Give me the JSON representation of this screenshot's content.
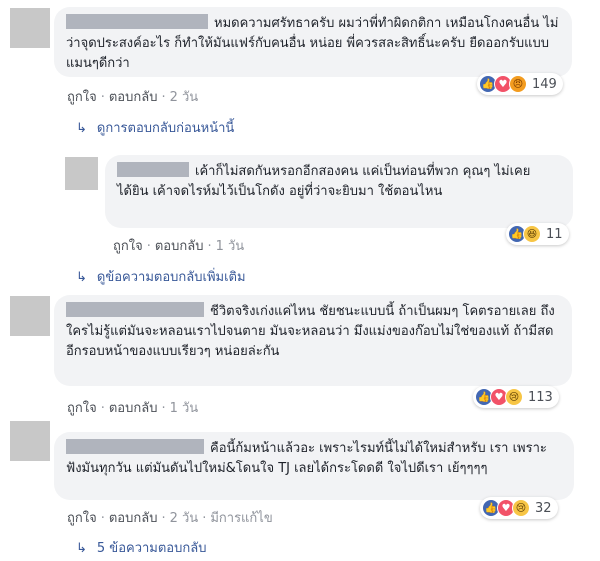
{
  "labels": {
    "like": "ถูกใจ",
    "reply": "ตอบกลับ",
    "dot": "·"
  },
  "comments": [
    {
      "text": "หมดความศรัทธาครับ ผมว่าพี่ทำผิดกติกา เหมือนโกงคนอื่น ไม่ว่าจุดประสงค์อะไร ก็ทำให้มันแฟร์กับคนอื่น หน่อย พี่ควรสละสิทธิ์นะครับ ยืดออกรับแบบแมนๆดีกว่า",
      "time": "2 วัน",
      "reaction_count": "149",
      "reaction_icons": [
        "like-icon",
        "love-icon",
        "angry-icon"
      ]
    },
    {
      "text": "เค้าก็ไม่สดกันหรอกอีกสองคน แค่เป็นท่อนที่พวก คุณๆ ไม่เคยได้ยิน เค้าจดไรห์มไว้เป็นโกดัง อยู่ที่ว่าจะยิบมา ใช้ตอนไหน",
      "time": "1 วัน",
      "reaction_count": "11",
      "reaction_icons": [
        "like-icon",
        "haha-icon"
      ]
    },
    {
      "text": "ชีวิตจริงเก่งแค่ไหน ชัยชนะแบบนี้ ถ้าเป็นผมๆ โคตรอายเลย ถึงใครไม่รู้แต่มันจะหลอนเราไปจนตาย มันจะหลอนว่า มึงแม่งของก๊อบไม่ใช่ของแท้ ถ้ามีสดอีกรอบหน้าของแบบเรียวๆ หน่อยล่ะกัน",
      "time": "1 วัน",
      "reaction_count": "113",
      "reaction_icons": [
        "like-icon",
        "love-icon",
        "sad-icon"
      ]
    },
    {
      "text": "คือนี้ก้มหน้าแล้วอะ เพราะไรมท์นี้ไม่ได้ใหม่สำหรับ เรา เพราะฟังมันทุกวัน แต่มันดันไปใหม่&โดนใจ TJ เลยได้กระโดดดี ใจไปดีเรา เย้ๆๆๆๆ",
      "time": "2 วัน",
      "edited": "มีการแก้ไข",
      "reaction_count": "32",
      "reaction_icons": [
        "like-icon",
        "love-icon",
        "sad-icon"
      ]
    }
  ],
  "links": {
    "prev_replies": "ดูการตอบกลับก่อนหน้านี้",
    "more_replies": "ดูข้อความตอบกลับเพิ่มเติม",
    "five_replies": "5 ข้อความตอบกลับ"
  },
  "colors": {
    "bubble": "#f2f3f5",
    "link": "#385898",
    "like": "#4267b2",
    "love": "#f25268"
  }
}
